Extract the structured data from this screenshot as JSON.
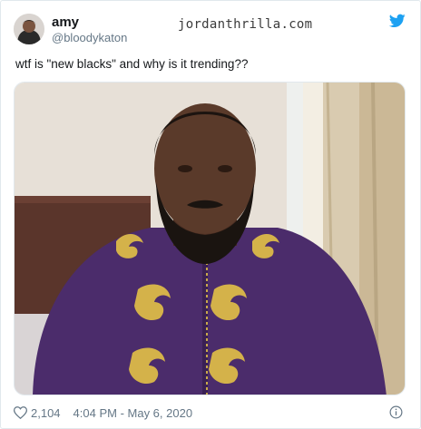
{
  "tweet": {
    "author": {
      "display_name": "amy",
      "handle": "@bloodykaton"
    },
    "watermark": "jordanthrilla.com",
    "text": "wtf is \"new blacks\" and why is it trending??",
    "likes": "2,104",
    "timestamp": "4:04 PM - May 6, 2020"
  },
  "icons": {
    "brand": "twitter-bird-icon",
    "like": "heart-icon",
    "info": "info-icon"
  },
  "colors": {
    "twitter_blue": "#1da1f2",
    "secondary_text": "#657786",
    "border": "#e1e8ed",
    "robe_purple": "#4b2c6b",
    "robe_gold": "#d4b24a"
  }
}
